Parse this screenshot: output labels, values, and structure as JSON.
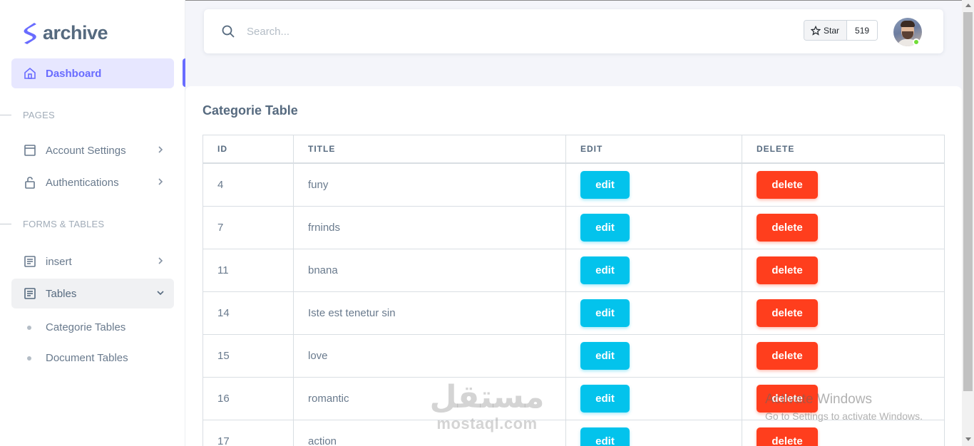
{
  "brand": {
    "name": "archive",
    "accent": "#696cff"
  },
  "sidebar": {
    "dashboard_label": "Dashboard",
    "section_pages": "PAGES",
    "account_settings": "Account Settings",
    "authentications": "Authentications",
    "section_forms": "FORMS & TABLES",
    "insert": "insert",
    "tables": "Tables",
    "sub_items": [
      "Categorie Tables",
      "Document Tables"
    ]
  },
  "navbar": {
    "search_placeholder": "Search...",
    "star_label": "Star",
    "star_count": "519"
  },
  "card": {
    "title": "Categorie Table",
    "columns": [
      "ID",
      "TITLE",
      "EDIT",
      "DELETE"
    ],
    "rows": [
      {
        "id": "4",
        "title": "funy",
        "edit": "edit",
        "delete": "delete"
      },
      {
        "id": "7",
        "title": "frninds",
        "edit": "edit",
        "delete": "delete"
      },
      {
        "id": "11",
        "title": "bnana",
        "edit": "edit",
        "delete": "delete"
      },
      {
        "id": "14",
        "title": "Iste est tenetur sin",
        "edit": "edit",
        "delete": "delete"
      },
      {
        "id": "15",
        "title": "love",
        "edit": "edit",
        "delete": "delete"
      },
      {
        "id": "16",
        "title": "romantic",
        "edit": "edit",
        "delete": "delete"
      },
      {
        "id": "17",
        "title": "action",
        "edit": "edit",
        "delete": "delete"
      }
    ]
  },
  "watermark": {
    "mostaql_ar": "مستقل",
    "mostaql_en": "mostaql.com",
    "windows_line1": "Activate Windows",
    "windows_line2": "Go to Settings to activate Windows."
  },
  "colors": {
    "info": "#03c3ec",
    "danger": "#ff3e1d",
    "online": "#71dd37"
  }
}
